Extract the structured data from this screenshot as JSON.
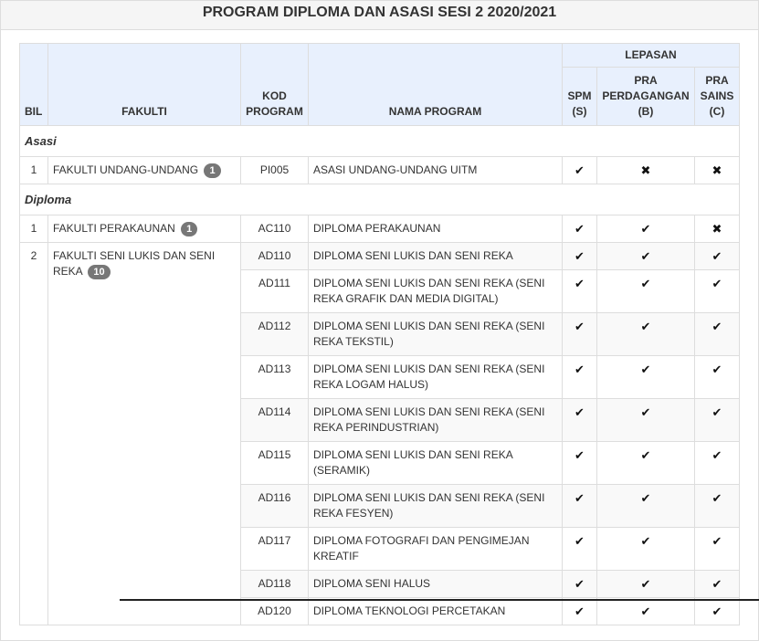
{
  "page": {
    "title": "PROGRAM DIPLOMA DAN ASASI SESI 2 2020/2021"
  },
  "headers": {
    "bil": "BIL",
    "fakulti": "FAKULTI",
    "kod": "KOD PROGRAM",
    "nama": "NAMA PROGRAM",
    "lepasan": "LEPASAN",
    "spm": "SPM (S)",
    "pra_perdagangan": "PRA PERDAGANGAN (B)",
    "pra_sains": "PRA SAINS (C)"
  },
  "marks": {
    "yes": "✔",
    "no": "✖"
  },
  "asasi": {
    "label": "Asasi",
    "rows": [
      {
        "bil": "1",
        "fakulti": "FAKULTI UNDANG-UNDANG",
        "count": "1",
        "kod": "PI005",
        "nama": "ASASI UNDANG-UNDANG UITM",
        "s": "✔",
        "b": "✖",
        "c": "✖"
      }
    ]
  },
  "diploma": {
    "label": "Diploma",
    "faculty1": {
      "bil": "1",
      "fakulti": "FAKULTI PERAKAUNAN",
      "count": "1"
    },
    "faculty2": {
      "bil": "2",
      "fakulti": "FAKULTI SENI LUKIS DAN SENI REKA",
      "count": "10"
    },
    "rows": [
      {
        "kod": "AC110",
        "nama": "DIPLOMA PERAKAUNAN",
        "s": "✔",
        "b": "✔",
        "c": "✖"
      },
      {
        "kod": "AD110",
        "nama": "DIPLOMA SENI LUKIS DAN SENI REKA",
        "s": "✔",
        "b": "✔",
        "c": "✔"
      },
      {
        "kod": "AD111",
        "nama": "DIPLOMA SENI LUKIS DAN SENI REKA (SENI REKA GRAFIK DAN MEDIA DIGITAL)",
        "s": "✔",
        "b": "✔",
        "c": "✔"
      },
      {
        "kod": "AD112",
        "nama": "DIPLOMA SENI LUKIS DAN SENI REKA (SENI REKA TEKSTIL)",
        "s": "✔",
        "b": "✔",
        "c": "✔"
      },
      {
        "kod": "AD113",
        "nama": "DIPLOMA SENI LUKIS DAN SENI REKA (SENI REKA LOGAM HALUS)",
        "s": "✔",
        "b": "✔",
        "c": "✔"
      },
      {
        "kod": "AD114",
        "nama": "DIPLOMA SENI LUKIS DAN SENI REKA (SENI REKA PERINDUSTRIAN)",
        "s": "✔",
        "b": "✔",
        "c": "✔"
      },
      {
        "kod": "AD115",
        "nama": "DIPLOMA SENI LUKIS DAN SENI REKA (SERAMIK)",
        "s": "✔",
        "b": "✔",
        "c": "✔"
      },
      {
        "kod": "AD116",
        "nama": "DIPLOMA SENI LUKIS DAN SENI REKA (SENI REKA FESYEN)",
        "s": "✔",
        "b": "✔",
        "c": "✔"
      },
      {
        "kod": "AD117",
        "nama": "DIPLOMA FOTOGRAFI DAN PENGIMEJAN KREATIF",
        "s": "✔",
        "b": "✔",
        "c": "✔"
      },
      {
        "kod": "AD118",
        "nama": "DIPLOMA SENI HALUS",
        "s": "✔",
        "b": "✔",
        "c": "✔"
      },
      {
        "kod": "AD120",
        "nama": "DIPLOMA TEKNOLOGI PERCETAKAN",
        "s": "✔",
        "b": "✔",
        "c": "✔"
      }
    ]
  }
}
